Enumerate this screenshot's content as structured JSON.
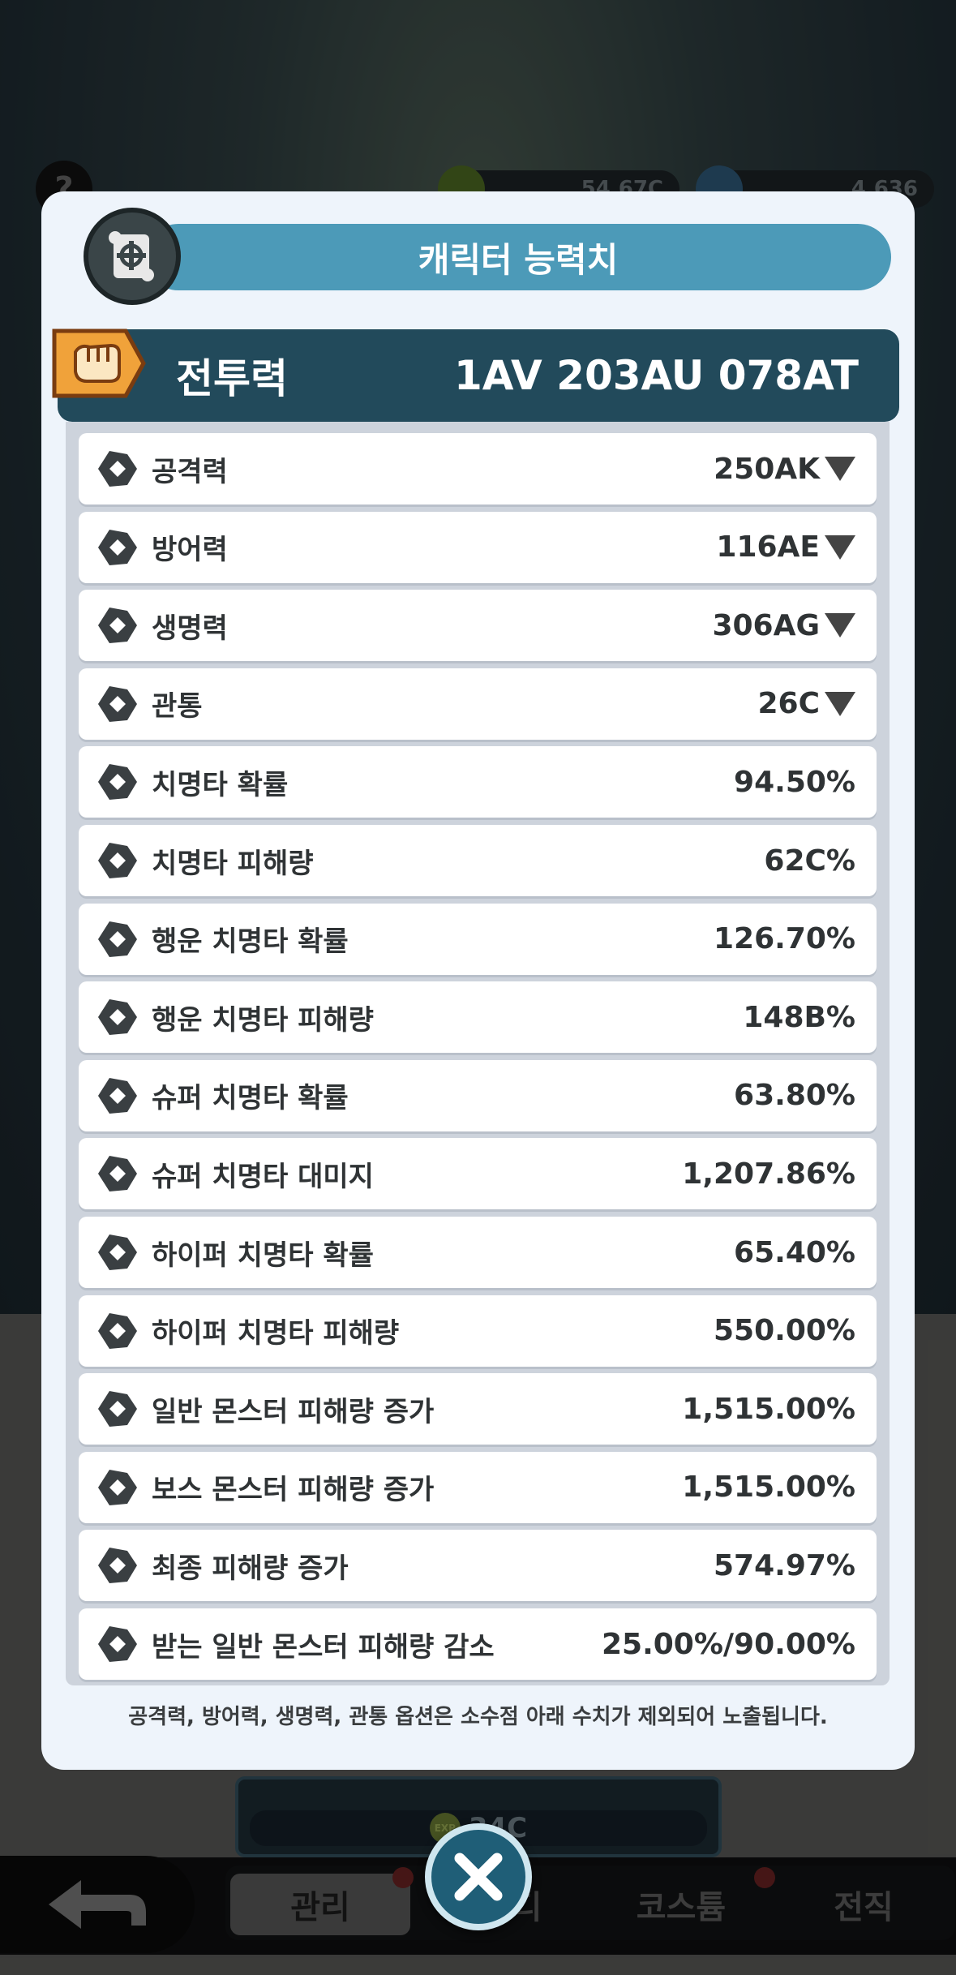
{
  "background": {
    "exp_currency": "54.67C",
    "gem_currency": "4,636",
    "help_label": "?",
    "mid_exp_value": "34C",
    "exp_badge": "EXP",
    "tabs": [
      "관리",
      "",
      "코스튬",
      "전직"
    ],
    "tab_partial": "디"
  },
  "modal": {
    "title": "캐릭터 능력치",
    "combat_power_label": "전투력",
    "combat_power_value": "1AV 203AU 078AT",
    "stats": [
      {
        "label": "공격력",
        "value": "250AK",
        "arrow": true,
        "icon": "attack-icon"
      },
      {
        "label": "방어력",
        "value": "116AE",
        "arrow": true,
        "icon": "defense-icon"
      },
      {
        "label": "생명력",
        "value": "306AG",
        "arrow": true,
        "icon": "health-icon"
      },
      {
        "label": "관통",
        "value": "26C",
        "arrow": true,
        "icon": "penetration-icon"
      },
      {
        "label": "치명타 확률",
        "value": "94.50%",
        "arrow": false,
        "icon": "crit-chance-icon"
      },
      {
        "label": "치명타 피해량",
        "value": "62C%",
        "arrow": false,
        "icon": "crit-damage-icon"
      },
      {
        "label": "행운 치명타 확률",
        "value": "126.70%",
        "arrow": false,
        "icon": "lucky-crit-chance-icon"
      },
      {
        "label": "행운 치명타 피해량",
        "value": "148B%",
        "arrow": false,
        "icon": "lucky-crit-damage-icon"
      },
      {
        "label": "슈퍼 치명타 확률",
        "value": "63.80%",
        "arrow": false,
        "icon": "super-crit-chance-icon"
      },
      {
        "label": "슈퍼 치명타 대미지",
        "value": "1,207.86%",
        "arrow": false,
        "icon": "super-crit-damage-icon"
      },
      {
        "label": "하이퍼 치명타 확률",
        "value": "65.40%",
        "arrow": false,
        "icon": "hyper-crit-chance-icon"
      },
      {
        "label": "하이퍼 치명타 피해량",
        "value": "550.00%",
        "arrow": false,
        "icon": "hyper-crit-damage-icon"
      },
      {
        "label": "일반 몬스터 피해량 증가",
        "value": "1,515.00%",
        "arrow": false,
        "icon": "normal-monster-damage-icon"
      },
      {
        "label": "보스 몬스터 피해량 증가",
        "value": "1,515.00%",
        "arrow": false,
        "icon": "boss-monster-damage-icon"
      },
      {
        "label": "최종 피해량 증가",
        "value": "574.97%",
        "arrow": false,
        "icon": "final-damage-icon"
      },
      {
        "label": "받는 일반 몬스터 피해량 감소",
        "value": "25.00%/90.00%",
        "arrow": false,
        "icon": "damage-taken-reduction-icon"
      }
    ],
    "footnote": "공격력, 방어력, 생명력, 관통 옵션은 소수점 아래 수치가 제외되어 노출됩니다."
  },
  "colors": {
    "title_bar": "#4c9ab8",
    "power_bar": "#224a5b",
    "panel": "#cdd3dc",
    "modal_bg": "#eef4fb",
    "icon_gold": "#f0a23a"
  }
}
